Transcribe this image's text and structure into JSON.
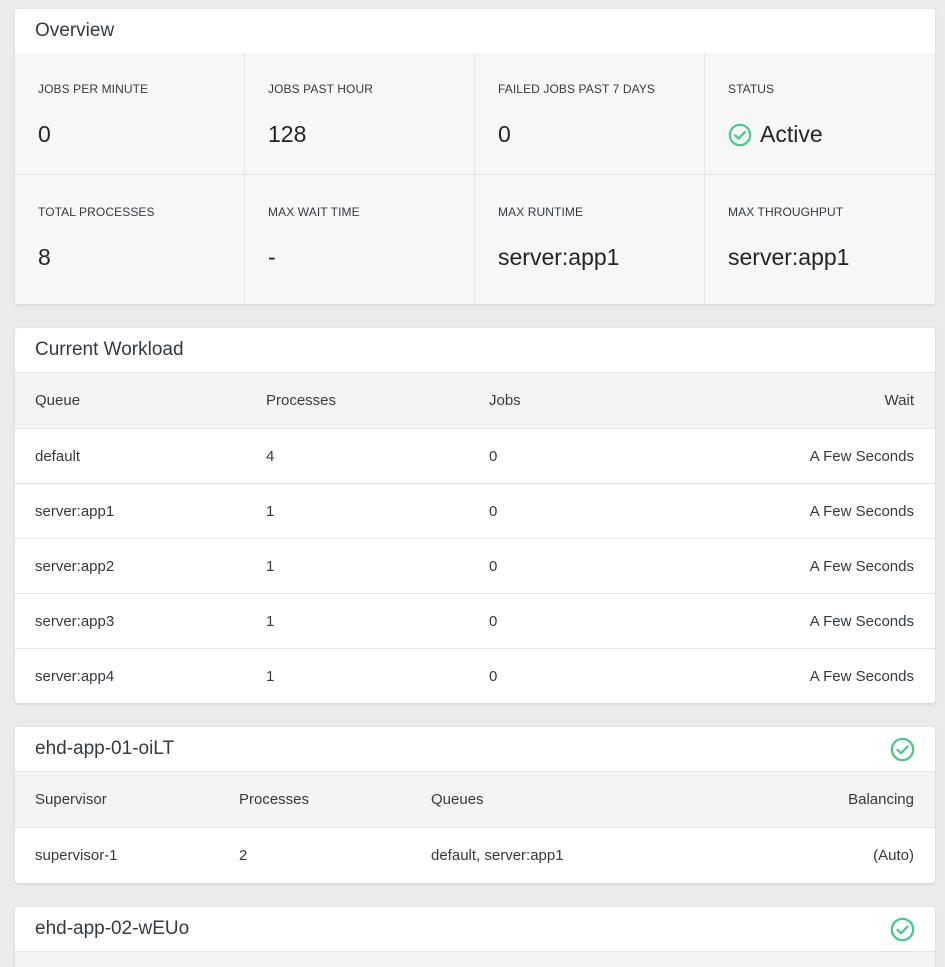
{
  "overview": {
    "title": "Overview",
    "stats": [
      {
        "label": "JOBS PER MINUTE",
        "value": "0"
      },
      {
        "label": "JOBS PAST HOUR",
        "value": "128"
      },
      {
        "label": "FAILED JOBS PAST 7 DAYS",
        "value": "0"
      },
      {
        "label": "STATUS",
        "value": "Active",
        "icon": "check-circle-icon"
      },
      {
        "label": "TOTAL PROCESSES",
        "value": "8"
      },
      {
        "label": "MAX WAIT TIME",
        "value": "-"
      },
      {
        "label": "MAX RUNTIME",
        "value": "server:app1"
      },
      {
        "label": "MAX THROUGHPUT",
        "value": "server:app1"
      }
    ]
  },
  "workload": {
    "title": "Current Workload",
    "columns": [
      "Queue",
      "Processes",
      "Jobs",
      "Wait"
    ],
    "rows": [
      [
        "default",
        "4",
        "0",
        "A Few Seconds"
      ],
      [
        "server:app1",
        "1",
        "0",
        "A Few Seconds"
      ],
      [
        "server:app2",
        "1",
        "0",
        "A Few Seconds"
      ],
      [
        "server:app3",
        "1",
        "0",
        "A Few Seconds"
      ],
      [
        "server:app4",
        "1",
        "0",
        "A Few Seconds"
      ]
    ]
  },
  "supervisors": [
    {
      "name": "ehd-app-01-oiLT",
      "status_icon": "check-circle-icon",
      "columns": [
        "Supervisor",
        "Processes",
        "Queues",
        "Balancing"
      ],
      "rows": [
        [
          "supervisor-1",
          "2",
          "default, server:app1",
          "(Auto)"
        ]
      ]
    },
    {
      "name": "ehd-app-02-wEUo",
      "status_icon": "check-circle-icon"
    }
  ],
  "colors": {
    "success": "#4ac78a",
    "background": "#ebebeb",
    "header_row": "#f3f4f6"
  }
}
